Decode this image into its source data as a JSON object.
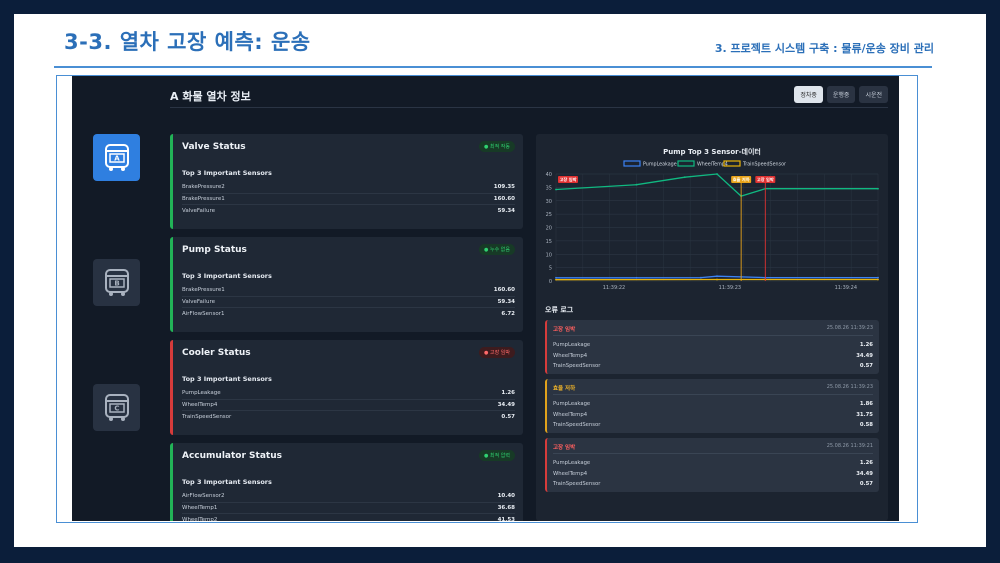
{
  "slide": {
    "title": "3-3. 열차 고장 예측: 운송",
    "subtitle": "3. 프로젝트 시스템 구축 : 물류/운송 장비 관리"
  },
  "app": {
    "title": "A 화물 열차 정보",
    "buttons": [
      "정차중",
      "운행중",
      "시운전"
    ],
    "active_button": "정차중"
  },
  "trains": [
    {
      "letter": "A",
      "active": true
    },
    {
      "letter": "B",
      "active": false
    },
    {
      "letter": "C",
      "active": false
    }
  ],
  "cards": [
    {
      "title": "Valve Status",
      "badge": "● 최적 작동",
      "status": "ok",
      "subtitle": "Top 3 Important Sensors",
      "rows": [
        {
          "name": "BrakePressure2",
          "value": "109.35"
        },
        {
          "name": "BrakePressure1",
          "value": "160.60"
        },
        {
          "name": "ValveFailure",
          "value": "59.34"
        }
      ]
    },
    {
      "title": "Pump Status",
      "badge": "● 누수 없음",
      "status": "ok",
      "subtitle": "Top 3 Important Sensors",
      "rows": [
        {
          "name": "BrakePressure1",
          "value": "160.60"
        },
        {
          "name": "ValveFailure",
          "value": "59.34"
        },
        {
          "name": "AirFlowSensor1",
          "value": "6.72"
        }
      ]
    },
    {
      "title": "Cooler Status",
      "badge": "● 고장 임박",
      "status": "bad",
      "subtitle": "Top 3 Important Sensors",
      "rows": [
        {
          "name": "PumpLeakage",
          "value": "1.26"
        },
        {
          "name": "WheelTemp4",
          "value": "34.49"
        },
        {
          "name": "TrainSpeedSensor",
          "value": "0.57"
        }
      ]
    },
    {
      "title": "Accumulator Status",
      "badge": "● 최적 압력",
      "status": "ok",
      "subtitle": "Top 3 Important Sensors",
      "rows": [
        {
          "name": "AirFlowSensor2",
          "value": "10.40"
        },
        {
          "name": "WheelTemp1",
          "value": "36.68"
        },
        {
          "name": "WheelTemp2",
          "value": "41.53"
        }
      ]
    }
  ],
  "chart_data": {
    "type": "line",
    "title": "Pump Top 3 Sensor-데이터",
    "x": [
      "11:39:22",
      "11:39:23",
      "11:39:24"
    ],
    "xticks": [
      "11:39:22",
      "11:39:23",
      "11:39:24"
    ],
    "ylim": [
      0,
      40
    ],
    "yticks": [
      0,
      5,
      10,
      15,
      20,
      25,
      30,
      35,
      40
    ],
    "series": [
      {
        "name": "PumpLeakage",
        "color": "#3b82f6",
        "points": [
          [
            0,
            1.2
          ],
          [
            0.5,
            1.2
          ],
          [
            0.9,
            1.26
          ],
          [
            1.0,
            1.8
          ],
          [
            1.3,
            1.26
          ],
          [
            2.0,
            1.26
          ]
        ]
      },
      {
        "name": "WheelTemp4",
        "color": "#10b981",
        "points": [
          [
            0,
            34.2
          ],
          [
            0.5,
            36.0
          ],
          [
            0.8,
            38.8
          ],
          [
            1.0,
            40.0
          ],
          [
            1.15,
            31.75
          ],
          [
            1.3,
            34.49
          ],
          [
            2.0,
            34.49
          ]
        ]
      },
      {
        "name": "TrainSpeedSensor",
        "color": "#eab308",
        "points": [
          [
            0,
            0.5
          ],
          [
            1.0,
            0.55
          ],
          [
            1.3,
            0.57
          ],
          [
            2.0,
            0.57
          ]
        ]
      }
    ],
    "annotations": [
      {
        "label": "고장 임박",
        "x": 0,
        "color": "#e03131"
      },
      {
        "label": "효율 저하",
        "x": 1.15,
        "color": "#e8a319"
      },
      {
        "label": "고장 임박",
        "x": 1.3,
        "color": "#e03131"
      }
    ],
    "grid": true,
    "legend": "top"
  },
  "logs": {
    "title": "오류 로그",
    "items": [
      {
        "type": "고장 임박",
        "level": "red",
        "time": "25.08.26 11:39:23",
        "rows": [
          {
            "name": "PumpLeakage",
            "value": "1.26"
          },
          {
            "name": "WheelTemp4",
            "value": "34.49"
          },
          {
            "name": "TrainSpeedSensor",
            "value": "0.57"
          }
        ]
      },
      {
        "type": "효율 저하",
        "level": "yellow",
        "time": "25.08.26 11:39:23",
        "rows": [
          {
            "name": "PumpLeakage",
            "value": "1.86"
          },
          {
            "name": "WheelTemp4",
            "value": "31.75"
          },
          {
            "name": "TrainSpeedSensor",
            "value": "0.58"
          }
        ]
      },
      {
        "type": "고장 임박",
        "level": "red",
        "time": "25.08.26 11:39:21",
        "rows": [
          {
            "name": "PumpLeakage",
            "value": "1.26"
          },
          {
            "name": "WheelTemp4",
            "value": "34.49"
          },
          {
            "name": "TrainSpeedSensor",
            "value": "0.57"
          }
        ]
      }
    ]
  }
}
